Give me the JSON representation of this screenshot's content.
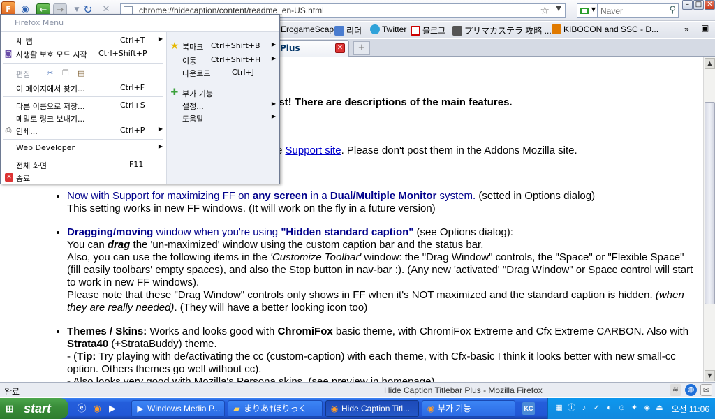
{
  "window": {
    "minimize_label": "–",
    "maximize_label": "□",
    "close_label": "✕"
  },
  "navbar": {
    "firefox_button_label": "F",
    "back_icon": "←",
    "forward_icon": "→",
    "reload_icon": "↻",
    "stop_icon": "✕",
    "url": "chrome://hidecaption/content/readme_en-US.html",
    "search_placeholder": "Naver"
  },
  "bookmarks": [
    {
      "label": "ErogameScape",
      "color": "#ffffff"
    },
    {
      "label": "리더",
      "color": "#4a7ccf"
    },
    {
      "label": "Twitter",
      "color": "#2fa2d9"
    },
    {
      "label": "블로그",
      "color": "#ffffff"
    },
    {
      "label": "プリマカステラ 攻略 ...",
      "color": "#555555"
    },
    {
      "label": "KIBOCON and SSC - D...",
      "color": "#e07a00"
    }
  ],
  "tab": {
    "title": "Plus",
    "close_label": "✕",
    "new_tab_label": "+"
  },
  "content": {
    "line1_link": "g",
    "line1_rest": " first! There are descriptions of the main features.",
    "line2_prefix": "e ",
    "line2_link": "Support site",
    "line2_rest": ". Please don't post them in the Addons Mozilla site.",
    "features": [
      {
        "p1": "Now with Support for maximizing FF on ",
        "p2": "any screen",
        "p3": " in a ",
        "p4": "Dual/Multiple Monitor",
        "p5": " system.",
        "p6": " (setted in Options dialog)",
        "p7": "This setting works in new FF windows. (It will work on the fly in a future version)"
      },
      {
        "p1": "Dragging/moving",
        "p2": " window when you're using ",
        "p3": "\"Hidden standard caption\"",
        "p4": " (see Options dialog):",
        "p5": "You can ",
        "p6": "drag",
        "p7": " the 'un-maximized' window using the custom caption bar and the status bar.",
        "p8": "Also, you can use the following items in the ",
        "p9": "'Customize Toolbar'",
        "p10": " window: the \"Drag Window\" controls, the \"Space\" or \"Flexible Space\" (fill easily toolbars' empty spaces), and also the Stop button in nav-bar :). (Any new 'activated' \"Drag Window\" or Space control will start to work in new FF windows).",
        "p11": "Please note that these \"Drag Window\" controls only shows in FF when it's NOT maximized and the standard caption is hidden. ",
        "p12": "(when they are really needed)",
        "p13": ". (They will have a better looking icon too)"
      },
      {
        "p1": "Themes / Skins:",
        "p2": " Works and looks good with ",
        "p3": "ChromiFox",
        "p4": " basic theme, with ChromiFox Extreme and Cfx Extreme CARBON. Also with ",
        "p5": "Strata40",
        "p6": " (+StrataBuddy) theme.",
        "p7": "- (",
        "p8": "Tip:",
        "p9": " Try playing with de/activating the cc (custom-caption) with each theme, with Cfx-basic I think it looks better with new small-cc option. Others themes go well without cc).",
        "p10": "- Also looks very good with Mozilla's Persona skins. (see preview in homepage)"
      }
    ]
  },
  "menu": {
    "title": "Firefox Menu",
    "left": {
      "new_tab": {
        "label": "새 탭",
        "shortcut": "Ctrl+T"
      },
      "private": {
        "label": "사생활 보호 모드 시작",
        "shortcut": "Ctrl+Shift+P"
      },
      "edit": {
        "label": "편집"
      },
      "find": {
        "label": "이 페이지에서 찾기...",
        "shortcut": "Ctrl+F"
      },
      "save_as": {
        "label": "다른 이름으로 저장...",
        "shortcut": "Ctrl+S"
      },
      "email_link": {
        "label": "메일로 링크 보내기..."
      },
      "print": {
        "label": "인쇄...",
        "shortcut": "Ctrl+P"
      },
      "web_developer": {
        "label": "Web Developer"
      },
      "fullscreen": {
        "label": "전체 화면",
        "shortcut": "F11"
      },
      "exit": {
        "label": "종료"
      }
    },
    "right": {
      "bookmarks": {
        "label": "북마크",
        "shortcut": "Ctrl+Shift+B"
      },
      "history": {
        "label": "이동",
        "shortcut": "Ctrl+Shift+H"
      },
      "downloads": {
        "label": "다운로드",
        "shortcut": "Ctrl+J"
      },
      "addons": {
        "label": "부가 기능"
      },
      "options": {
        "label": "설정..."
      },
      "help": {
        "label": "도움말"
      }
    }
  },
  "statusbar": {
    "status_text": "완료",
    "window_title": "Hide Caption Titlebar Plus - Mozilla Firefox"
  },
  "taskbar": {
    "start_label": "start",
    "tasks": [
      {
        "label": "Windows Media P...",
        "active": false
      },
      {
        "label": "まりあ†ほりっく",
        "active": false
      },
      {
        "label": "Hide Caption Titl...",
        "active": true
      },
      {
        "label": "부가 기능",
        "active": false
      }
    ],
    "clock": "오전 11:06"
  },
  "colors": {
    "link_blue": "#0000cc",
    "feature_blue": "#00008b",
    "taskbar_blue": "#245edb",
    "start_green": "#3a8e3a"
  }
}
